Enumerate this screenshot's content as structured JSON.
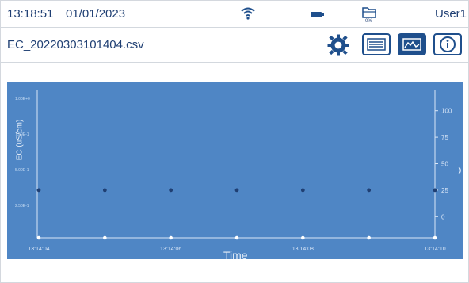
{
  "status": {
    "time": "13:18:51",
    "date": "01/01/2023",
    "user": "User1",
    "storage_label": "0%"
  },
  "file": {
    "name": "EC_20220303101404.csv"
  },
  "toolbar": {
    "settings_icon": "gear-icon",
    "list_icon": "list-icon",
    "graph_icon": "chart-icon",
    "info_icon": "info-icon"
  },
  "colors": {
    "primary": "#1f4f8c",
    "plot_background": "#4f86c5"
  },
  "chart_data": {
    "type": "scatter",
    "xlabel": "Time",
    "ylabel": "EC (uS/cm)",
    "x_ticks": [
      "13:14:04",
      "13:14:06",
      "13:14:08",
      "13:14:10"
    ],
    "left_ticks": [
      "1.00E+0",
      "7.50E-1",
      "5.00E-1",
      "2.50E-1"
    ],
    "right_ticks": [
      "100",
      "75",
      "50",
      "25",
      "0"
    ],
    "series": [
      {
        "values": [
          25,
          25,
          25,
          25,
          25,
          25,
          25
        ],
        "x": [
          "13:14:04",
          "13:14:05",
          "13:14:06",
          "13:14:07",
          "13:14:08",
          "13:14:09",
          "13:14:10"
        ]
      }
    ],
    "right_ylim": [
      -20,
      120
    ],
    "grid": false
  }
}
